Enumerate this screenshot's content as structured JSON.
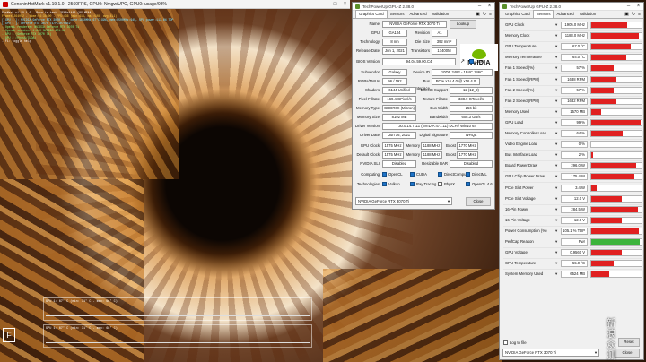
{
  "game": {
    "title": "GenshinHotMark v1.19.1.0 - 2560FPS, GPU0: NmgwiUPC, GPU0: usage/98%",
    "osd_lines": [
      {
        "text": "FurMark v1.19.1.0 - Burn-in test, 2560x1440 (8X MSAA)",
        "c": "w"
      },
      {
        "text": "Frames:264002 - time:04:38:00 - FPS:436 (min:413, max:508, avg:411)",
        "c": "y"
      },
      {
        "text": "[ GPU 1 ]: NVIDIA GeForce RTX 3070 Ti - core:1950MHz:67°C:99%, mem:9500MHz:64%, GPU power:113.6% TDP",
        "c": "c"
      },
      {
        "text": "[ GPU 1 ]: GeForce RTX 3070 Ti/PCIe/SSE2",
        "c": "c"
      },
      {
        "text": "- OpenGL renderer: NVIDIA GeForce RTX 3070 Ti",
        "c": "g"
      },
      {
        "text": "- OpenGL version: 4.6.0 NVIDIA 471.11",
        "c": "g"
      },
      {
        "text": "- GPU 1 (GeForce RTX 3070 Ti)",
        "c": "g"
      },
      {
        "text": "- GPU 2 (PhysX/CUDA)",
        "c": "g"
      },
      {
        "text": "- F1: toggle help",
        "c": "w"
      }
    ],
    "graph1": "GPU 1: 67° C (min: 31° C - max: 68° C)",
    "graph2": "GPU 1: 67° C (min: 31° C - max: 68° C)",
    "logo": "F"
  },
  "gpuz1": {
    "title": "TechPowerUp GPU-Z 2.38.0",
    "tabs": [
      "Graphics Card",
      "Sensors",
      "Advanced",
      "Validation"
    ],
    "labels": {
      "name": "Name",
      "gpu": "GPU",
      "revision": "Revision",
      "technology": "Technology",
      "die_size": "Die Size",
      "release_date": "Release Date",
      "transistors": "Transistors",
      "bios": "BIOS Version",
      "subvendor": "Subvendor",
      "device_id": "Device ID",
      "rops": "ROPs/TMUs",
      "bus_interface": "Bus Interface",
      "shaders": "Shaders",
      "directx": "DirectX Support",
      "pixel": "Pixel Fillrate",
      "texture": "Texture Fillrate",
      "mem_type": "Memory Type",
      "bus_width": "Bus Width",
      "mem_size": "Memory Size",
      "bandwidth": "Bandwidth",
      "driver_version": "Driver Version",
      "driver_date": "Driver Date",
      "signature": "Digital Signature",
      "gpu_clock": "GPU Clock",
      "memory": "Memory",
      "boost": "Boost",
      "default_clock": "Default Clock",
      "sli": "NVIDIA SLI",
      "rebar": "Resizable BAR",
      "computing": "Computing",
      "technologies": "Technologies"
    },
    "values": {
      "name": "NVIDIA GeForce RTX 3070 Ti",
      "gpu": "GA104",
      "revision": "A1",
      "technology": "8 nm",
      "die_size": "392 mm²",
      "release_date": "Jun 1, 2021",
      "transistors": "17400M",
      "bios": "94.04.59.00.C4",
      "subvendor": "Galaxy",
      "device_id": "10DE 2482 - 1B4C 146C",
      "rops": "96 / 192",
      "bus_interface": "PCIe x16 4.0 @ x16 4.0",
      "shaders": "6144 Unified",
      "directx": "12 (12_2)",
      "pixel": "169.4 GPixel/s",
      "texture": "338.9 GTexel/s",
      "mem_type": "GDDR6X (Micron)",
      "bus_width": "256 bit",
      "mem_size": "8192 MB",
      "bandwidth": "608.3 GB/s",
      "driver_version": "30.0.14.7111 (NVIDIA 471.11) DCH / Win10 64",
      "driver_date": "Jun 16, 2021",
      "signature": "WHQL",
      "gpu_clock": "1575 MHz",
      "memory_clock": "1188 MHz",
      "boost": "1770 MHz",
      "default_clock": "1575 MHz",
      "default_memory": "1188 MHz",
      "default_boost": "1770 MHz",
      "sli": "Disabled",
      "rebar": "Disabled"
    },
    "lookup": "Lookup",
    "uefi": "UEFI",
    "computing": [
      {
        "t": "OpenCL",
        "on": true
      },
      {
        "t": "CUDA",
        "on": true
      },
      {
        "t": "DirectCompute",
        "on": true
      },
      {
        "t": "DirectML",
        "on": true
      }
    ],
    "technologies": [
      {
        "t": "Vulkan",
        "on": true
      },
      {
        "t": "Ray Tracing",
        "on": true
      },
      {
        "t": "PhysX",
        "on": false
      },
      {
        "t": "OpenGL 4.6",
        "on": true
      }
    ],
    "bottom_select": "NVIDIA GeForce RTX 3070 Ti",
    "close": "Close",
    "nvidia": "NVIDIA"
  },
  "gpuz2": {
    "title": "TechPowerUp GPU-Z 2.38.0",
    "tabs": [
      "Graphics Card",
      "Sensors",
      "Advanced",
      "Validation"
    ],
    "sensors": [
      {
        "n": "GPU Clock",
        "v": "1905.0 MHz",
        "f": 0.72
      },
      {
        "n": "Memory Clock",
        "v": "1188.0 MHz",
        "f": 0.95
      },
      {
        "n": "GPU Temperature",
        "v": "67.0 °C",
        "f": 0.78
      },
      {
        "n": "Memory Temperature",
        "v": "64.0 °C",
        "f": 0.7
      },
      {
        "n": "Fan 1 Speed (%)",
        "v": "57 %",
        "f": 0.45
      },
      {
        "n": "Fan 1 Speed (RPM)",
        "v": "1638 RPM",
        "f": 0.5
      },
      {
        "n": "Fan 2 Speed (%)",
        "v": "57 %",
        "f": 0.45
      },
      {
        "n": "Fan 2 Speed (RPM)",
        "v": "1632 RPM",
        "f": 0.5
      },
      {
        "n": "Memory Used",
        "v": "1570 MB",
        "f": 0.2
      },
      {
        "n": "GPU Load",
        "v": "99 %",
        "f": 0.98
      },
      {
        "n": "Memory Controller Load",
        "v": "64 %",
        "f": 0.62
      },
      {
        "n": "Video Engine Load",
        "v": "0 %",
        "f": 0.0
      },
      {
        "n": "Bus Interface Load",
        "v": "2 %",
        "f": 0.03
      },
      {
        "n": "Board Power Draw",
        "v": "296.0 W",
        "f": 0.9
      },
      {
        "n": "GPU Chip Power Draw",
        "v": "175.4 W",
        "f": 0.85
      },
      {
        "n": "PCIe Slot Power",
        "v": "3.4 W",
        "f": 0.1
      },
      {
        "n": "PCIe Slot Voltage",
        "v": "12.0 V",
        "f": 0.6
      },
      {
        "n": "16-Pin Power",
        "v": "284.5 W",
        "f": 0.92
      },
      {
        "n": "16-Pin Voltage",
        "v": "12.0 V",
        "f": 0.6
      },
      {
        "n": "Power Consumption (%)",
        "v": "105.1 % TDP",
        "f": 0.95
      },
      {
        "n": "PerfCap Reason",
        "v": "Pwr",
        "f": 0.97
      },
      {
        "n": "GPU Voltage",
        "v": "0.9560 V",
        "f": 0.6
      },
      {
        "n": "CPU Temperature",
        "v": "55.0 °C",
        "f": 0.45
      },
      {
        "n": "System Memory Used",
        "v": "6524 MB",
        "f": 0.35
      }
    ],
    "log": "Log to file",
    "reset": "Reset",
    "bottom_select": "NVIDIA GeForce RTX 3070 Ti",
    "close": "Close",
    "colors": {
      "bar": "#e02020",
      "perfcap": "#3cb43c"
    }
  },
  "watermark": "新\n浪\n众\n测"
}
